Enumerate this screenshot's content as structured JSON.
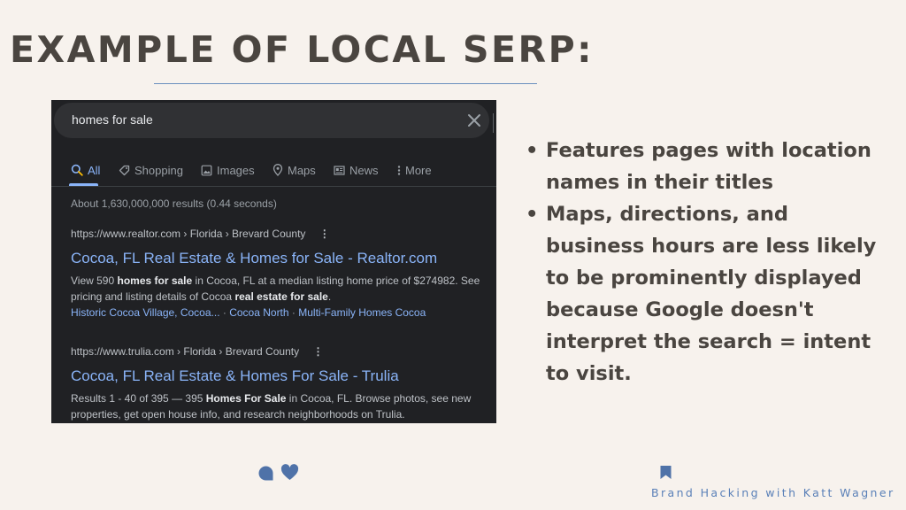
{
  "slide": {
    "title": "EXAMPLE OF LOCAL SERP:",
    "bullets": [
      "Features pages with location names in their titles",
      "Maps, directions, and business hours are less likely to be prominently displayed because Google doesn't interpret the search = intent to visit."
    ],
    "footer": "Brand Hacking with Katt Wagner",
    "accent_color": "#5a80b8",
    "text_color": "#4a4540",
    "background_color": "#f7f2ed"
  },
  "serp": {
    "query": "homes for sale",
    "tabs": [
      {
        "label": "All",
        "icon": "search-icon",
        "active": true
      },
      {
        "label": "Shopping",
        "icon": "tag-icon",
        "active": false
      },
      {
        "label": "Images",
        "icon": "image-icon",
        "active": false
      },
      {
        "label": "Maps",
        "icon": "map-pin-icon",
        "active": false
      },
      {
        "label": "News",
        "icon": "news-icon",
        "active": false
      },
      {
        "label": "More",
        "icon": "more-vert-icon",
        "active": false
      }
    ],
    "stats": "About 1,630,000,000 results (0.44 seconds)",
    "results": [
      {
        "cite": "https://www.realtor.com › Florida › Brevard County",
        "title": "Cocoa, FL Real Estate & Homes for Sale - Realtor.com",
        "snippet_parts": [
          {
            "text": "View 590 ",
            "bold": false
          },
          {
            "text": "homes for sale",
            "bold": true
          },
          {
            "text": " in Cocoa, FL at a median listing home price of $274982. See pricing and listing details of Cocoa ",
            "bold": false
          },
          {
            "text": "real estate for sale",
            "bold": true
          },
          {
            "text": ".",
            "bold": false
          }
        ],
        "sitelinks": [
          "Historic Cocoa Village, Cocoa...",
          "Cocoa North",
          "Multi-Family Homes Cocoa"
        ]
      },
      {
        "cite": "https://www.trulia.com › Florida › Brevard County",
        "title": "Cocoa, FL Real Estate & Homes For Sale - Trulia",
        "snippet_parts": [
          {
            "text": "Results 1 - 40 of 395 — 395 ",
            "bold": false
          },
          {
            "text": "Homes For Sale",
            "bold": true
          },
          {
            "text": " in Cocoa, FL. Browse photos, see new properties, get open house info, and research neighborhoods on Trulia.",
            "bold": false
          }
        ],
        "sitelinks": []
      }
    ],
    "colors": {
      "background": "#202124",
      "link": "#8ab4f8",
      "text": "#bdc1c6",
      "muted": "#9aa0a6"
    }
  }
}
